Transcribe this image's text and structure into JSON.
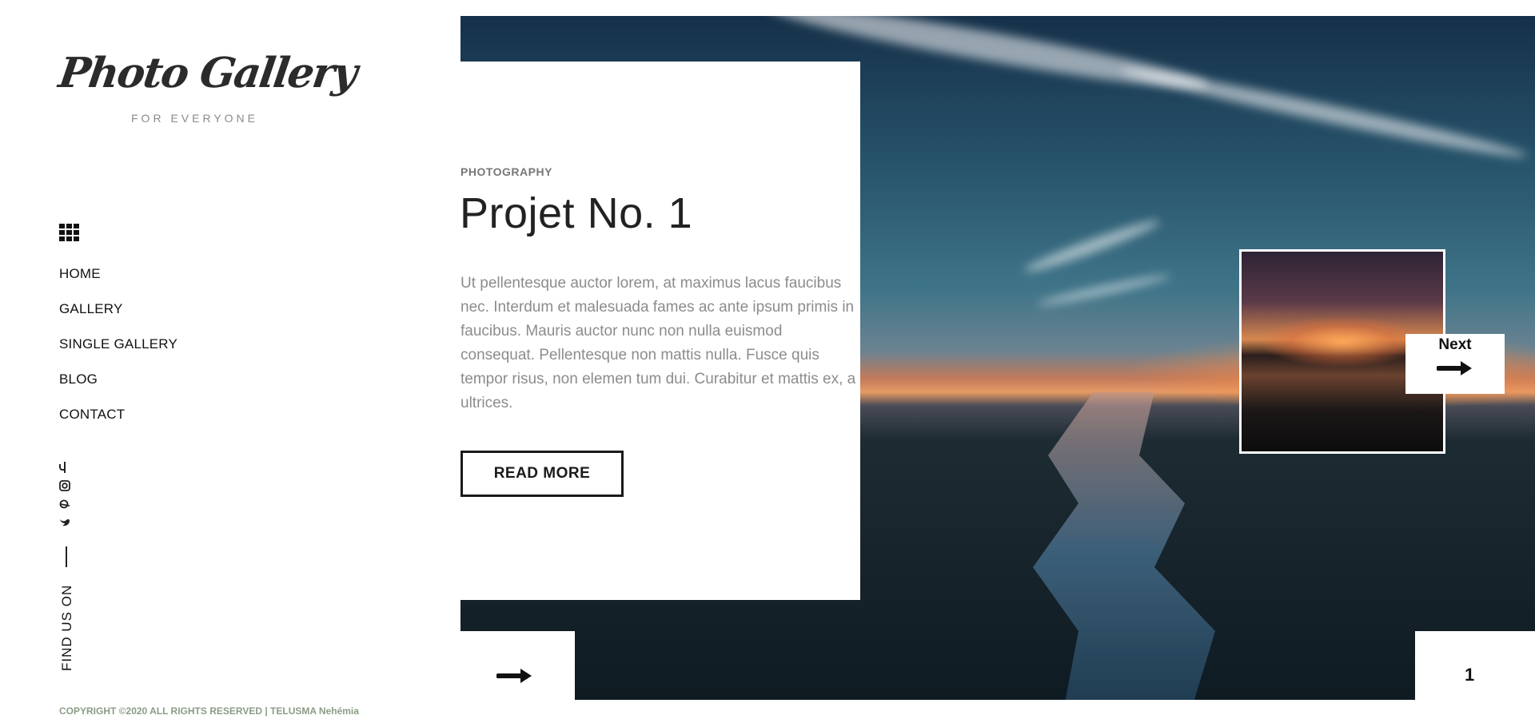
{
  "logo": {
    "script": "Photo Gallery",
    "tagline": "FOR EVERYONE"
  },
  "nav": {
    "items": [
      {
        "label": "HOME"
      },
      {
        "label": "GALLERY"
      },
      {
        "label": "SINGLE GALLERY"
      },
      {
        "label": "BLOG"
      },
      {
        "label": "CONTACT"
      }
    ]
  },
  "social": {
    "icons": [
      "facebook-icon",
      "instagram-icon",
      "pinterest-icon",
      "twitter-icon"
    ],
    "find_us_label": "FIND US ON"
  },
  "footer": {
    "copyright": "COPYRIGHT ©2020 ALL RIGHTS RESERVED | TELUSMA Nehémia"
  },
  "project": {
    "category": "PHOTOGRAPHY",
    "title": "Projet No. 1",
    "description": "Ut pellentesque auctor lorem, at maximus lacus faucibus nec. Interdum et malesuada fames ac ante ipsum primis in faucibus. Mauris auctor nunc non nulla euismod consequat. Pellentesque non mattis nulla. Fusce quis tempor risus, non elemen tum dui. Curabitur et mattis ex, a ultrices.",
    "read_more_label": "READ MORE"
  },
  "slider": {
    "next_label": "Next",
    "page_number": "1"
  },
  "colors": {
    "text": "#111111",
    "muted": "#8c8c8c",
    "copyright": "#8a9c86",
    "sky_top": "#153049",
    "sunset": "#e79a64"
  }
}
